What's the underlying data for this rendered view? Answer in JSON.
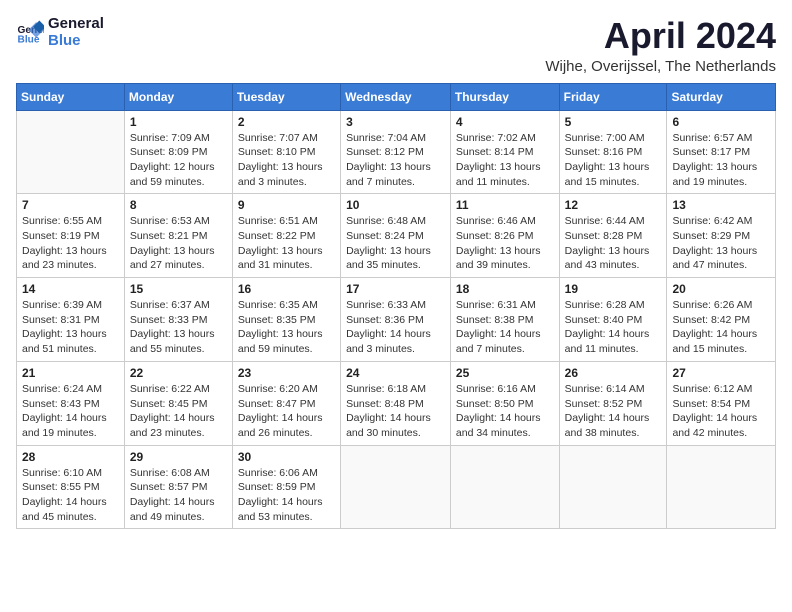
{
  "logo": {
    "line1": "General",
    "line2": "Blue"
  },
  "title": "April 2024",
  "subtitle": "Wijhe, Overijssel, The Netherlands",
  "days_of_week": [
    "Sunday",
    "Monday",
    "Tuesday",
    "Wednesday",
    "Thursday",
    "Friday",
    "Saturday"
  ],
  "weeks": [
    [
      {
        "day": "",
        "info": ""
      },
      {
        "day": "1",
        "info": "Sunrise: 7:09 AM\nSunset: 8:09 PM\nDaylight: 12 hours\nand 59 minutes."
      },
      {
        "day": "2",
        "info": "Sunrise: 7:07 AM\nSunset: 8:10 PM\nDaylight: 13 hours\nand 3 minutes."
      },
      {
        "day": "3",
        "info": "Sunrise: 7:04 AM\nSunset: 8:12 PM\nDaylight: 13 hours\nand 7 minutes."
      },
      {
        "day": "4",
        "info": "Sunrise: 7:02 AM\nSunset: 8:14 PM\nDaylight: 13 hours\nand 11 minutes."
      },
      {
        "day": "5",
        "info": "Sunrise: 7:00 AM\nSunset: 8:16 PM\nDaylight: 13 hours\nand 15 minutes."
      },
      {
        "day": "6",
        "info": "Sunrise: 6:57 AM\nSunset: 8:17 PM\nDaylight: 13 hours\nand 19 minutes."
      }
    ],
    [
      {
        "day": "7",
        "info": "Sunrise: 6:55 AM\nSunset: 8:19 PM\nDaylight: 13 hours\nand 23 minutes."
      },
      {
        "day": "8",
        "info": "Sunrise: 6:53 AM\nSunset: 8:21 PM\nDaylight: 13 hours\nand 27 minutes."
      },
      {
        "day": "9",
        "info": "Sunrise: 6:51 AM\nSunset: 8:22 PM\nDaylight: 13 hours\nand 31 minutes."
      },
      {
        "day": "10",
        "info": "Sunrise: 6:48 AM\nSunset: 8:24 PM\nDaylight: 13 hours\nand 35 minutes."
      },
      {
        "day": "11",
        "info": "Sunrise: 6:46 AM\nSunset: 8:26 PM\nDaylight: 13 hours\nand 39 minutes."
      },
      {
        "day": "12",
        "info": "Sunrise: 6:44 AM\nSunset: 8:28 PM\nDaylight: 13 hours\nand 43 minutes."
      },
      {
        "day": "13",
        "info": "Sunrise: 6:42 AM\nSunset: 8:29 PM\nDaylight: 13 hours\nand 47 minutes."
      }
    ],
    [
      {
        "day": "14",
        "info": "Sunrise: 6:39 AM\nSunset: 8:31 PM\nDaylight: 13 hours\nand 51 minutes."
      },
      {
        "day": "15",
        "info": "Sunrise: 6:37 AM\nSunset: 8:33 PM\nDaylight: 13 hours\nand 55 minutes."
      },
      {
        "day": "16",
        "info": "Sunrise: 6:35 AM\nSunset: 8:35 PM\nDaylight: 13 hours\nand 59 minutes."
      },
      {
        "day": "17",
        "info": "Sunrise: 6:33 AM\nSunset: 8:36 PM\nDaylight: 14 hours\nand 3 minutes."
      },
      {
        "day": "18",
        "info": "Sunrise: 6:31 AM\nSunset: 8:38 PM\nDaylight: 14 hours\nand 7 minutes."
      },
      {
        "day": "19",
        "info": "Sunrise: 6:28 AM\nSunset: 8:40 PM\nDaylight: 14 hours\nand 11 minutes."
      },
      {
        "day": "20",
        "info": "Sunrise: 6:26 AM\nSunset: 8:42 PM\nDaylight: 14 hours\nand 15 minutes."
      }
    ],
    [
      {
        "day": "21",
        "info": "Sunrise: 6:24 AM\nSunset: 8:43 PM\nDaylight: 14 hours\nand 19 minutes."
      },
      {
        "day": "22",
        "info": "Sunrise: 6:22 AM\nSunset: 8:45 PM\nDaylight: 14 hours\nand 23 minutes."
      },
      {
        "day": "23",
        "info": "Sunrise: 6:20 AM\nSunset: 8:47 PM\nDaylight: 14 hours\nand 26 minutes."
      },
      {
        "day": "24",
        "info": "Sunrise: 6:18 AM\nSunset: 8:48 PM\nDaylight: 14 hours\nand 30 minutes."
      },
      {
        "day": "25",
        "info": "Sunrise: 6:16 AM\nSunset: 8:50 PM\nDaylight: 14 hours\nand 34 minutes."
      },
      {
        "day": "26",
        "info": "Sunrise: 6:14 AM\nSunset: 8:52 PM\nDaylight: 14 hours\nand 38 minutes."
      },
      {
        "day": "27",
        "info": "Sunrise: 6:12 AM\nSunset: 8:54 PM\nDaylight: 14 hours\nand 42 minutes."
      }
    ],
    [
      {
        "day": "28",
        "info": "Sunrise: 6:10 AM\nSunset: 8:55 PM\nDaylight: 14 hours\nand 45 minutes."
      },
      {
        "day": "29",
        "info": "Sunrise: 6:08 AM\nSunset: 8:57 PM\nDaylight: 14 hours\nand 49 minutes."
      },
      {
        "day": "30",
        "info": "Sunrise: 6:06 AM\nSunset: 8:59 PM\nDaylight: 14 hours\nand 53 minutes."
      },
      {
        "day": "",
        "info": ""
      },
      {
        "day": "",
        "info": ""
      },
      {
        "day": "",
        "info": ""
      },
      {
        "day": "",
        "info": ""
      }
    ]
  ]
}
